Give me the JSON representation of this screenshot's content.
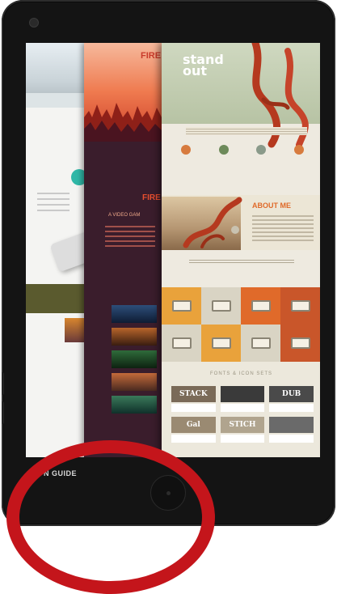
{
  "caption": {
    "text": "N GUIDE"
  },
  "layer2": {
    "title_top": "FIRE",
    "title_mid": "FIRE",
    "subtitle": "A VIDEO GAM"
  },
  "layer3": {
    "hero_title_line1": "stand",
    "hero_title_line2": "out",
    "about_title": "ABOUT ME",
    "fonts_title": "FONTS & ICON SETS",
    "font_cards": [
      "STACK",
      "",
      "DUB",
      "Gal",
      "STICH",
      ""
    ]
  },
  "colors": {
    "ring": "#c4151b",
    "accent_orange": "#e06a2a"
  }
}
